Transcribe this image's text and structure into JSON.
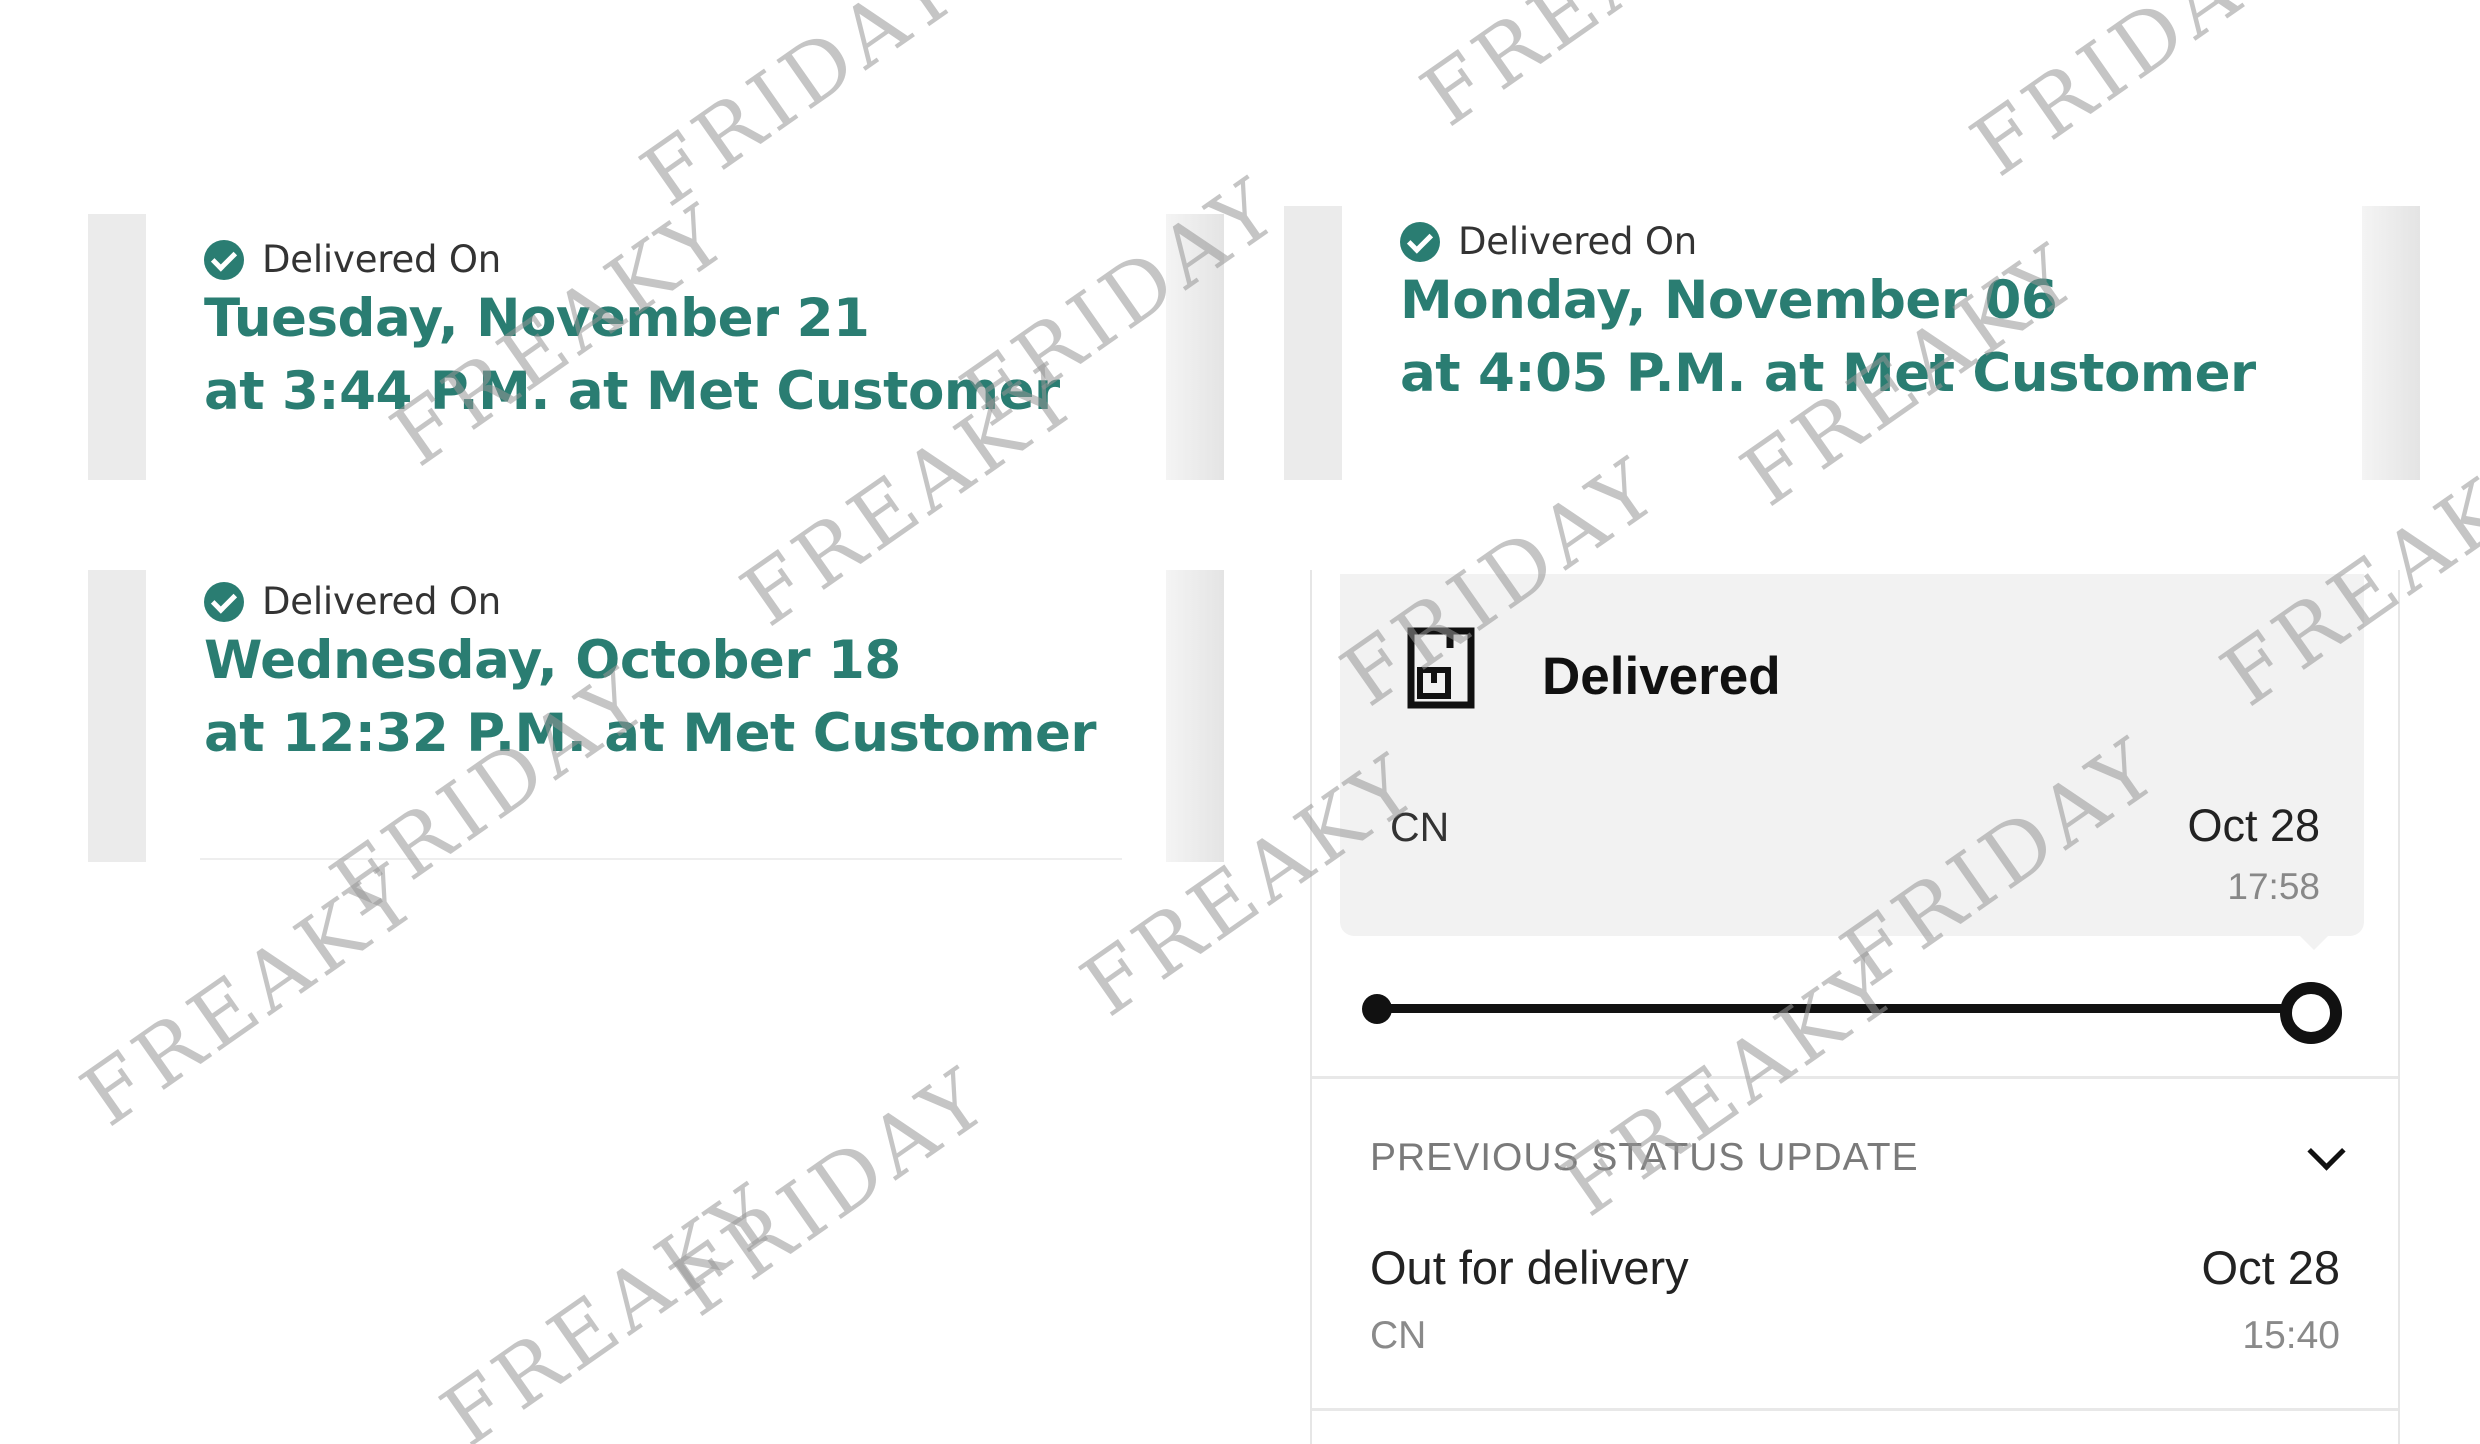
{
  "cards": [
    {
      "label": "Delivered On",
      "date": "Tuesday, November 21",
      "time_line": "at 3:44 P.M. at Met Customer"
    },
    {
      "label": "Delivered On",
      "date": "Monday, November 06",
      "time_line": "at 4:05 P.M. at Met Customer"
    },
    {
      "label": "Delivered On",
      "date": "Wednesday, October 18",
      "time_line": "at 12:32 P.M. at Met Customer"
    }
  ],
  "tracking": {
    "status": "Delivered",
    "location": "CN",
    "date": "Oct 28",
    "time": "17:58",
    "progress": 1.0,
    "previous_header": "PREVIOUS STATUS UPDATE",
    "previous": {
      "event": "Out for delivery",
      "location": "CN",
      "date": "Oct 28",
      "time": "15:40"
    }
  },
  "watermark": {
    "text_a": "FREAKY",
    "text_b": "FRIDAY"
  },
  "colors": {
    "accent": "#2a7d72",
    "progress": "#111111"
  }
}
